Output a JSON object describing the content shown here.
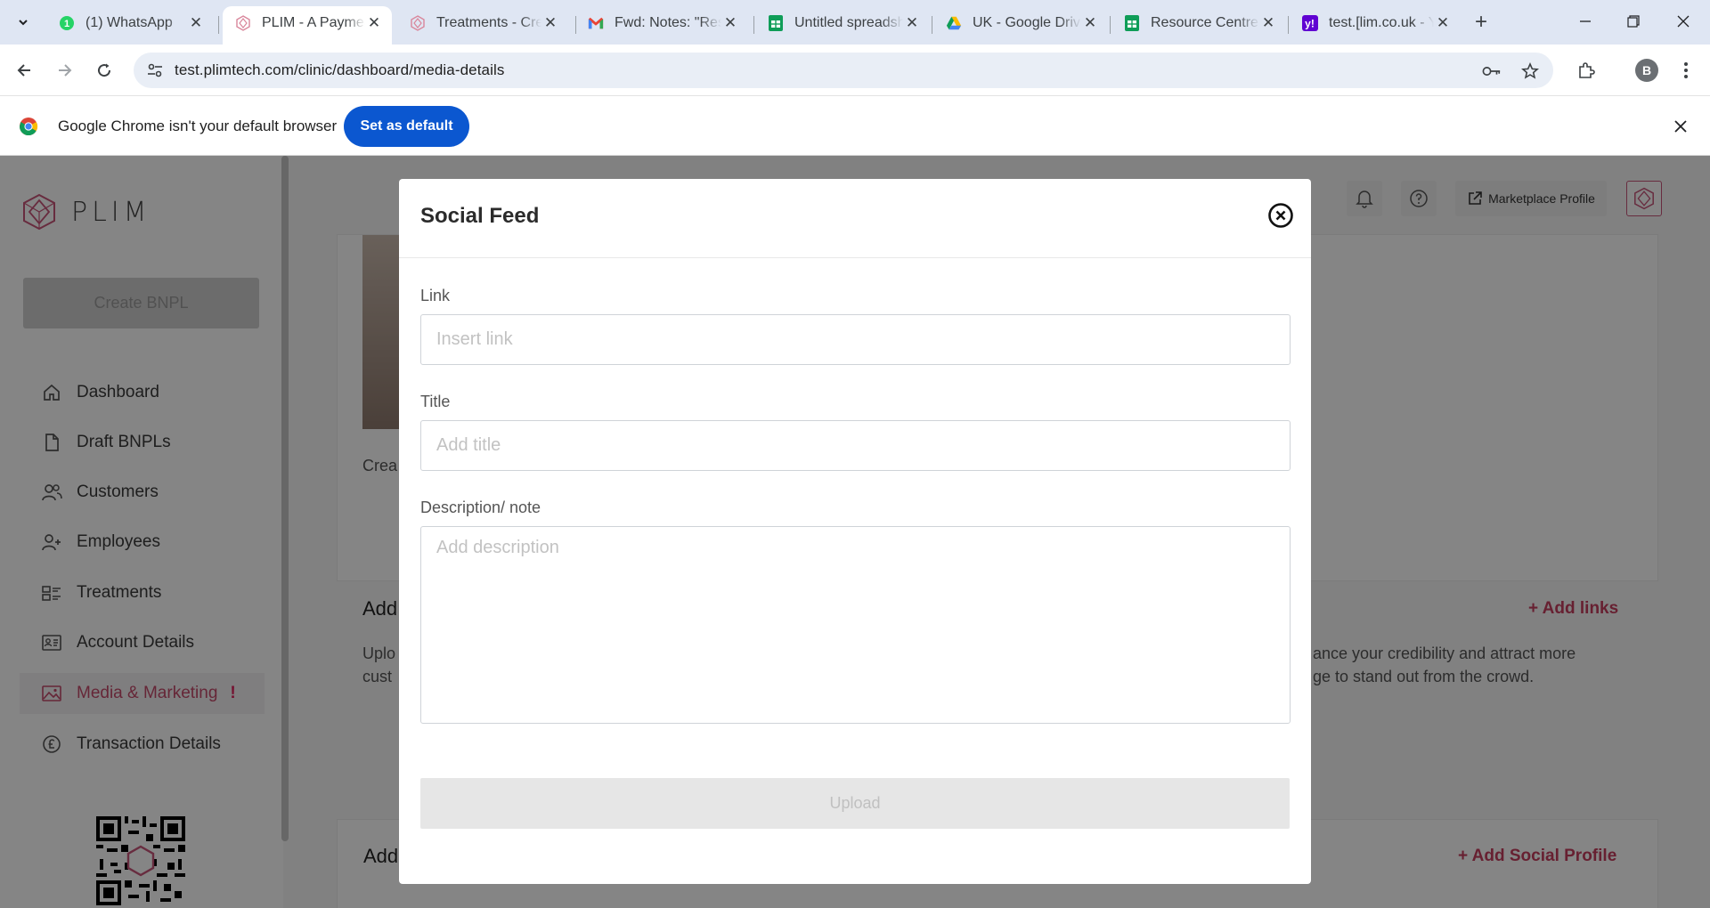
{
  "tabs": [
    {
      "label": "(1) WhatsApp",
      "icon": "whatsapp-icon",
      "active": false
    },
    {
      "label": "PLIM - A Payment",
      "icon": "plim-icon",
      "active": true
    },
    {
      "label": "Treatments - Create",
      "icon": "plim-icon",
      "active": false
    },
    {
      "label": "Fwd: Notes: \"Resource",
      "icon": "gmail-icon",
      "active": false
    },
    {
      "label": "Untitled spreadsheet",
      "icon": "sheets-icon",
      "active": false
    },
    {
      "label": "UK - Google Drive",
      "icon": "drive-icon",
      "active": false
    },
    {
      "label": "Resource Centre",
      "icon": "sheets-icon",
      "active": false
    },
    {
      "label": "test.[lim.co.uk - Yahoo",
      "icon": "yahoo-icon",
      "active": false
    }
  ],
  "address": {
    "url": "test.plimtech.com/clinic/dashboard/media-details"
  },
  "profile_initial": "B",
  "infobar": {
    "message": "Google Chrome isn't your default browser",
    "button": "Set as default"
  },
  "sidebar": {
    "logo_text": "PLIM",
    "create_button": "Create BNPL",
    "items": [
      {
        "label": "Dashboard",
        "icon": "home-icon"
      },
      {
        "label": "Draft BNPLs",
        "icon": "document-icon"
      },
      {
        "label": "Customers",
        "icon": "users-icon"
      },
      {
        "label": "Employees",
        "icon": "user-add-icon"
      },
      {
        "label": "Treatments",
        "icon": "treatments-icon"
      },
      {
        "label": "Account Details",
        "icon": "id-card-icon"
      },
      {
        "label": "Media & Marketing",
        "icon": "image-icon",
        "active": true,
        "alert": "!"
      },
      {
        "label": "Transaction Details",
        "icon": "pound-icon"
      }
    ]
  },
  "header": {
    "marketplace_button": "Marketplace Profile"
  },
  "background": {
    "card1_caption": "Crea",
    "links_title": "Add",
    "links_action": "+ Add links",
    "links_text_left_1": "Uplo",
    "links_text_left_2": "cust",
    "links_text_right_1": "ance your credibility and attract more",
    "links_text_right_2": "ge to stand out from the crowd.",
    "social_title": "Add",
    "social_action": "+ Add Social Profile"
  },
  "modal": {
    "title": "Social Feed",
    "link_label": "Link",
    "link_placeholder": "Insert link",
    "link_value": "",
    "title_label": "Title",
    "title_placeholder": "Add title",
    "title_value": "",
    "description_label": "Description/ note",
    "description_placeholder": "Add description",
    "description_value": "",
    "upload_button": "Upload"
  },
  "colors": {
    "accent": "#c53e5e",
    "chrome_blue": "#0b57d0",
    "tabstrip_bg": "#dfe6f3"
  }
}
